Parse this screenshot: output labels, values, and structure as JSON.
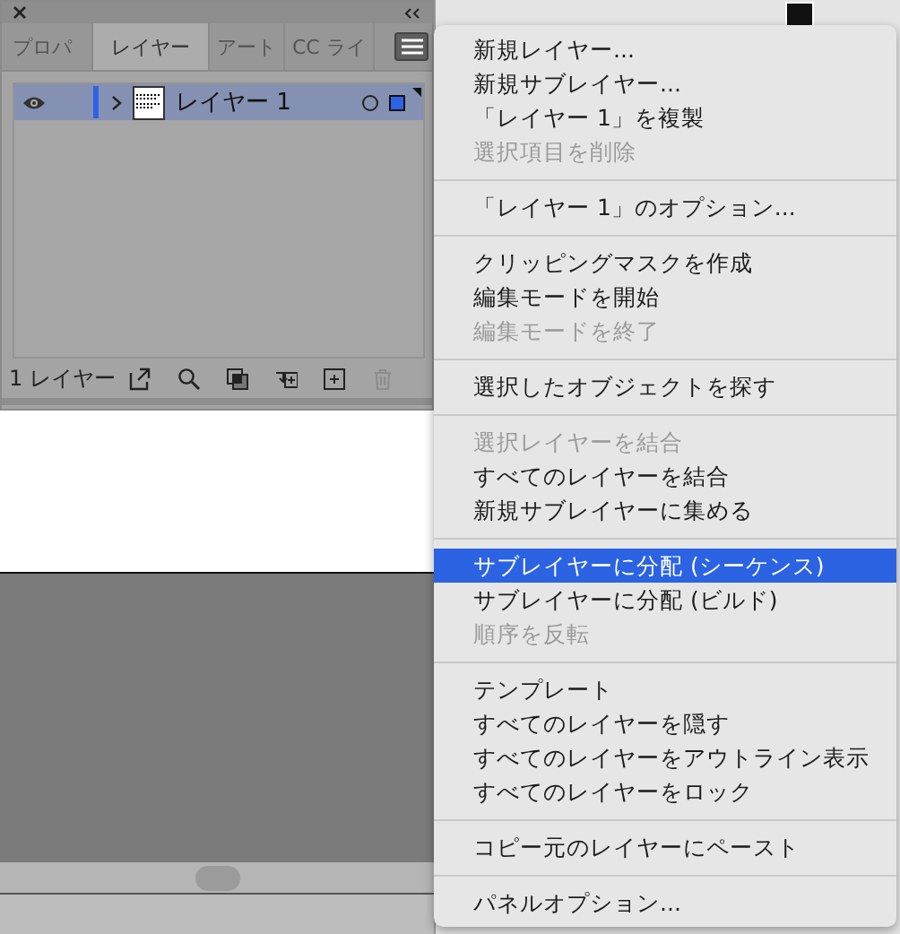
{
  "panel": {
    "tabs": [
      {
        "label": "プロパ",
        "selected": false
      },
      {
        "label": "レイヤー",
        "selected": true
      },
      {
        "label": "アート",
        "selected": false
      },
      {
        "label": "CC ライ",
        "selected": false
      }
    ],
    "layers": [
      {
        "name": "レイヤー 1",
        "visible": true,
        "selected": true,
        "expanded": false
      }
    ],
    "layer_count": "1 レイヤー",
    "footer_buttons": [
      {
        "kind": "export",
        "disabled": false
      },
      {
        "kind": "search",
        "disabled": false
      },
      {
        "kind": "mask",
        "disabled": false
      },
      {
        "kind": "move",
        "disabled": false
      },
      {
        "kind": "add",
        "disabled": false
      },
      {
        "kind": "trash",
        "disabled": true
      }
    ]
  },
  "menu": {
    "sections": [
      [
        {
          "label": "新規レイヤー...",
          "disabled": false,
          "selected": false
        },
        {
          "label": "新規サブレイヤー...",
          "disabled": false,
          "selected": false
        },
        {
          "label": "「レイヤー 1」を複製",
          "disabled": false,
          "selected": false
        },
        {
          "label": "選択項目を削除",
          "disabled": true,
          "selected": false
        }
      ],
      [
        {
          "label": "「レイヤー 1」のオプション...",
          "disabled": false,
          "selected": false
        }
      ],
      [
        {
          "label": "クリッピングマスクを作成",
          "disabled": false,
          "selected": false
        },
        {
          "label": "編集モードを開始",
          "disabled": false,
          "selected": false
        },
        {
          "label": "編集モードを終了",
          "disabled": true,
          "selected": false
        }
      ],
      [
        {
          "label": "選択したオブジェクトを探す",
          "disabled": false,
          "selected": false
        }
      ],
      [
        {
          "label": "選択レイヤーを結合",
          "disabled": true,
          "selected": false
        },
        {
          "label": "すべてのレイヤーを結合",
          "disabled": false,
          "selected": false
        },
        {
          "label": "新規サブレイヤーに集める",
          "disabled": false,
          "selected": false
        }
      ],
      [
        {
          "label": "サブレイヤーに分配 (シーケンス)",
          "disabled": false,
          "selected": true
        },
        {
          "label": "サブレイヤーに分配 (ビルド)",
          "disabled": false,
          "selected": false
        },
        {
          "label": "順序を反転",
          "disabled": true,
          "selected": false
        }
      ],
      [
        {
          "label": "テンプレート",
          "disabled": false,
          "selected": false
        },
        {
          "label": "すべてのレイヤーを隠す",
          "disabled": false,
          "selected": false
        },
        {
          "label": "すべてのレイヤーをアウトライン表示",
          "disabled": false,
          "selected": false
        },
        {
          "label": "すべてのレイヤーをロック",
          "disabled": false,
          "selected": false
        }
      ],
      [
        {
          "label": "コピー元のレイヤーにペースト",
          "disabled": false,
          "selected": false
        }
      ],
      [
        {
          "label": "パネルオプション...",
          "disabled": false,
          "selected": false
        }
      ]
    ]
  }
}
